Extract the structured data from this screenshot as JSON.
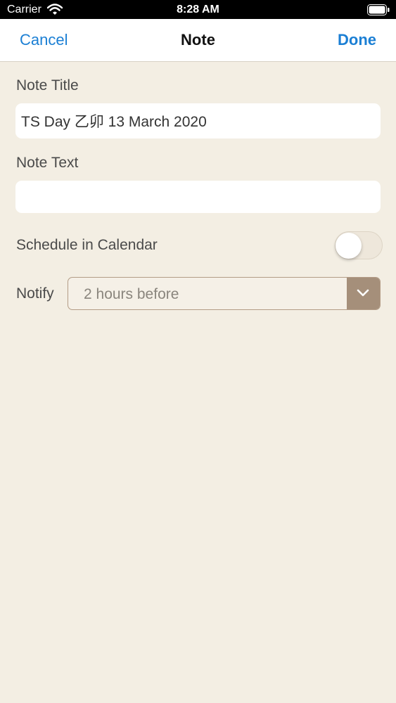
{
  "status_bar": {
    "carrier": "Carrier",
    "time": "8:28 AM"
  },
  "nav": {
    "cancel_label": "Cancel",
    "title": "Note",
    "done_label": "Done"
  },
  "form": {
    "note_title_label": "Note Title",
    "note_title_value": "TS Day 乙卯 13 March 2020",
    "note_text_label": "Note Text",
    "note_text_value": "",
    "schedule_label": "Schedule in Calendar",
    "schedule_enabled": false,
    "notify_label": "Notify",
    "notify_value": "2 hours before"
  },
  "colors": {
    "accent": "#1b7fd4",
    "background": "#f3eee3",
    "select_button": "#a58f7a"
  },
  "icons": {
    "wifi": "wifi-icon",
    "battery": "battery-icon",
    "dropdown": "chevron-down-icon"
  }
}
